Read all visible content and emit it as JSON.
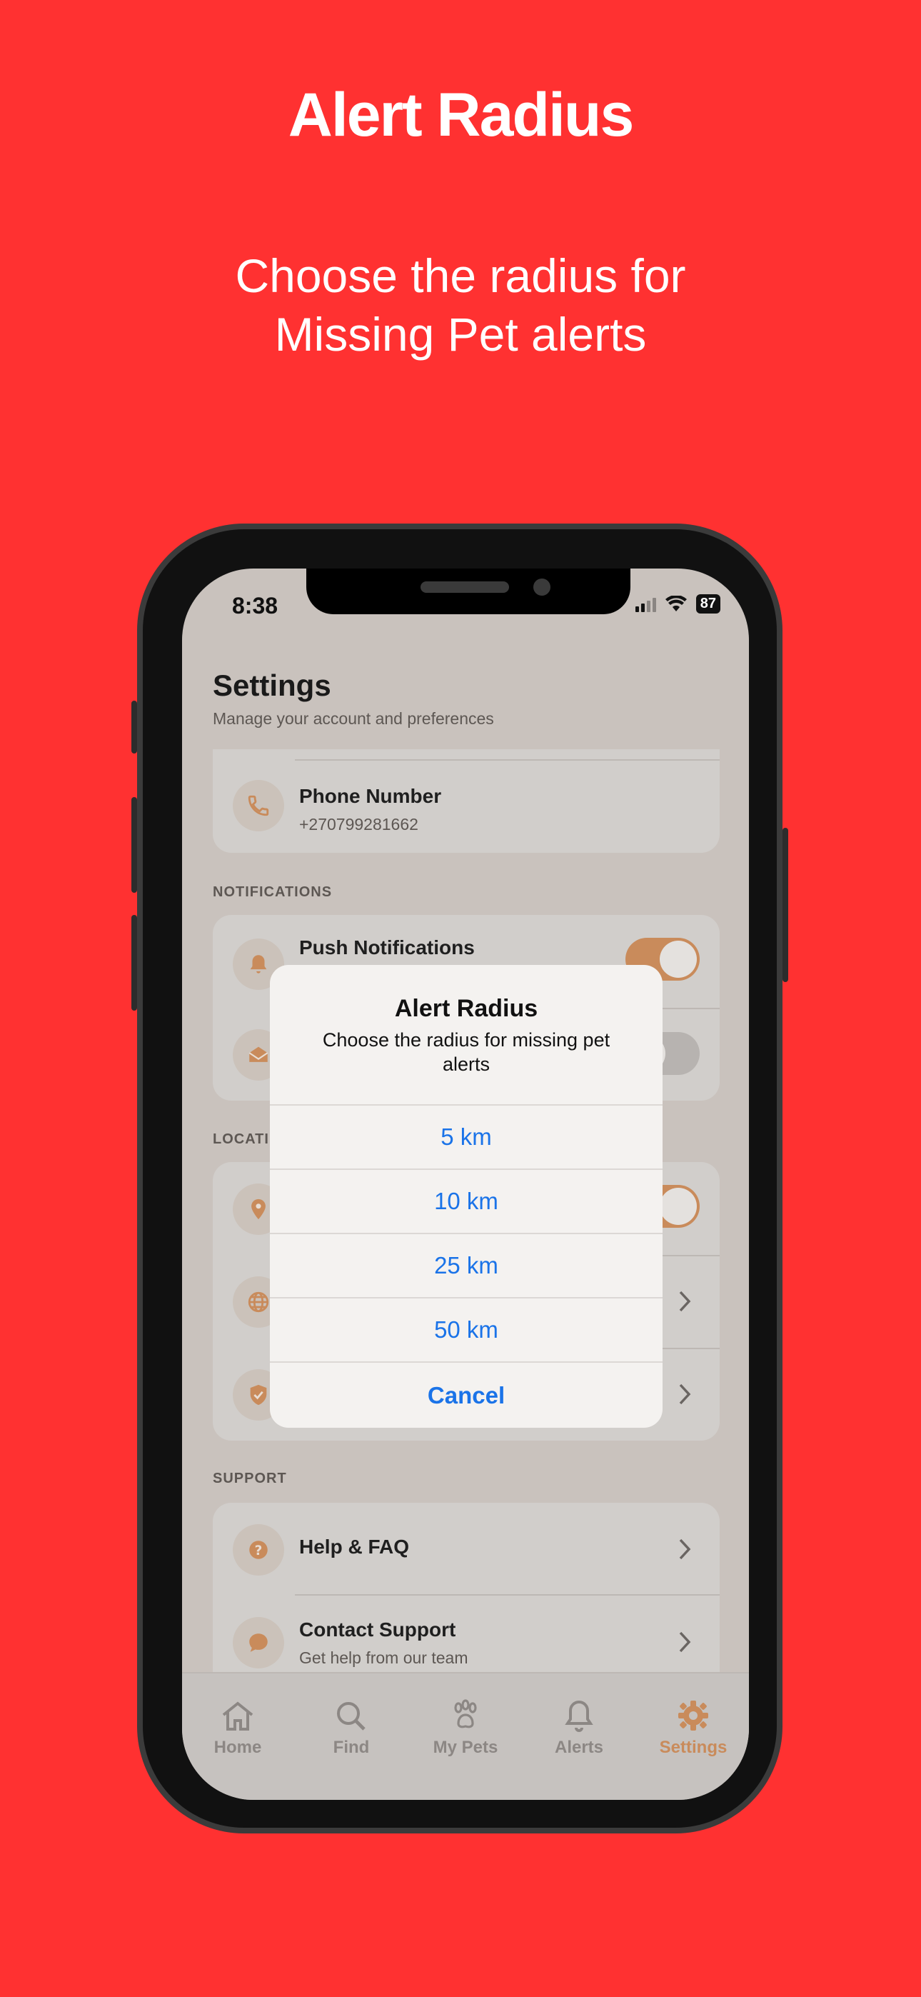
{
  "promo": {
    "title": "Alert Radius",
    "subtitle": "Choose the radius for\nMissing Pet alerts",
    "background_color": "#ff3131"
  },
  "status_bar": {
    "time": "8:38",
    "battery": "87"
  },
  "settings": {
    "title": "Settings",
    "subtitle": "Manage your account and preferences",
    "phone_row": {
      "label": "Phone Number",
      "value": "+270799281662",
      "icon": "phone-icon"
    },
    "notifications_section": "NOTIFICATIONS",
    "push_notifications_label": "Push Notifications",
    "push_notifications_on": true,
    "email_notifications_on": false,
    "location_section": "LOCATI",
    "location_toggle_on": true,
    "support_section": "SUPPORT",
    "help_row": {
      "label": "Help & FAQ",
      "icon": "question-icon"
    },
    "contact_row": {
      "label": "Contact Support",
      "sub": "Get help from our team",
      "icon": "chat-icon"
    }
  },
  "tabs": [
    {
      "label": "Home",
      "icon": "home-icon",
      "active": false
    },
    {
      "label": "Find",
      "icon": "search-icon",
      "active": false
    },
    {
      "label": "My Pets",
      "icon": "paw-icon",
      "active": false
    },
    {
      "label": "Alerts",
      "icon": "bell-icon",
      "active": false
    },
    {
      "label": "Settings",
      "icon": "gear-icon",
      "active": true
    }
  ],
  "dialog": {
    "title": "Alert Radius",
    "message": "Choose the radius for missing pet alerts",
    "options": [
      "5 km",
      "10 km",
      "25 km",
      "50 km"
    ],
    "cancel": "Cancel"
  },
  "colors": {
    "accent": "#c98b5b",
    "link": "#1a73e8"
  }
}
